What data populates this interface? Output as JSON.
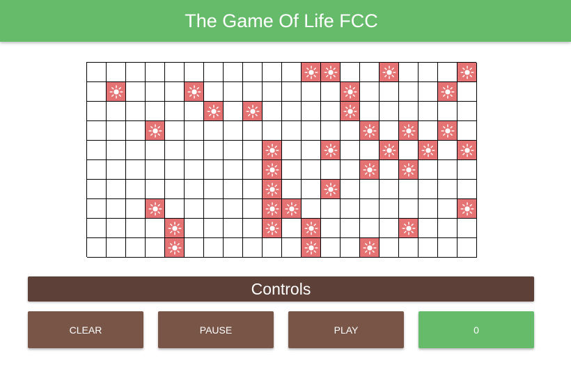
{
  "header": {
    "title": "The Game Of Life FCC"
  },
  "board": {
    "rows": 10,
    "cols": 20,
    "cell_icon": "sun-icon",
    "alive_color": "#e57373",
    "alive_cells": [
      [
        0,
        11
      ],
      [
        0,
        12
      ],
      [
        0,
        15
      ],
      [
        0,
        19
      ],
      [
        1,
        1
      ],
      [
        1,
        5
      ],
      [
        1,
        13
      ],
      [
        1,
        18
      ],
      [
        2,
        6
      ],
      [
        2,
        8
      ],
      [
        2,
        13
      ],
      [
        3,
        3
      ],
      [
        3,
        14
      ],
      [
        3,
        16
      ],
      [
        3,
        18
      ],
      [
        4,
        9
      ],
      [
        4,
        12
      ],
      [
        4,
        15
      ],
      [
        4,
        17
      ],
      [
        4,
        19
      ],
      [
        5,
        9
      ],
      [
        5,
        14
      ],
      [
        5,
        16
      ],
      [
        6,
        9
      ],
      [
        6,
        12
      ],
      [
        7,
        3
      ],
      [
        7,
        9
      ],
      [
        7,
        10
      ],
      [
        7,
        19
      ],
      [
        8,
        4
      ],
      [
        8,
        9
      ],
      [
        8,
        11
      ],
      [
        8,
        16
      ],
      [
        9,
        4
      ],
      [
        9,
        11
      ],
      [
        9,
        14
      ]
    ]
  },
  "controls": {
    "title": "Controls",
    "clear_label": "CLEAR",
    "pause_label": "PAUSE",
    "play_label": "PLAY",
    "generation": "0"
  },
  "colors": {
    "header_bg": "#66bb6a",
    "controls_bar_bg": "#5d4037",
    "button_bg": "#795548",
    "generation_bg": "#66bb6a"
  }
}
